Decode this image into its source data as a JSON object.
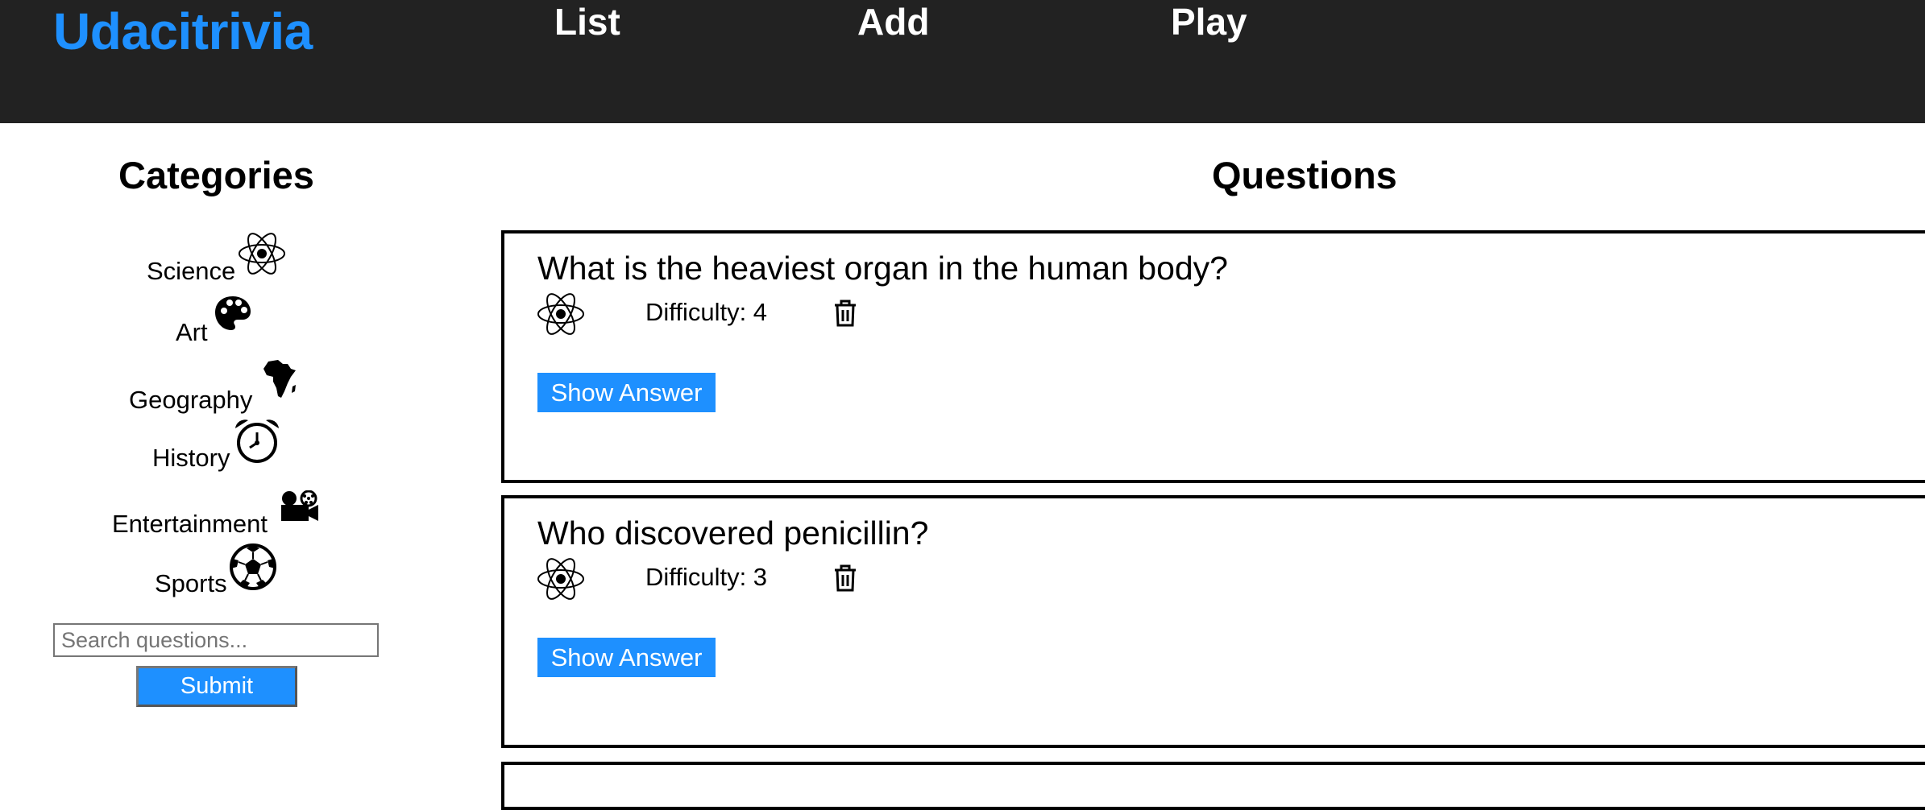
{
  "header": {
    "brand": "Udacitrivia",
    "nav": {
      "list": "List",
      "add": "Add",
      "play": "Play"
    }
  },
  "sidebar": {
    "title": "Categories",
    "categories": [
      {
        "label": "Science",
        "icon": "science-icon"
      },
      {
        "label": "Art",
        "icon": "art-icon"
      },
      {
        "label": "Geography",
        "icon": "geography-icon"
      },
      {
        "label": "History",
        "icon": "history-icon"
      },
      {
        "label": "Entertainment",
        "icon": "entertainment-icon"
      },
      {
        "label": "Sports",
        "icon": "sports-icon"
      }
    ],
    "search": {
      "placeholder": "Search questions...",
      "value": ""
    },
    "submit_label": "Submit"
  },
  "main": {
    "title": "Questions",
    "questions": [
      {
        "text": "What is the heaviest organ in the human body?",
        "difficulty": "Difficulty: 4",
        "category_icon": "science-icon",
        "show_answer_label": "Show Answer"
      },
      {
        "text": "Who discovered penicillin?",
        "difficulty": "Difficulty: 3",
        "category_icon": "science-icon",
        "show_answer_label": "Show Answer"
      }
    ]
  },
  "colors": {
    "header_bg": "#222222",
    "brand": "#1e90ff",
    "button": "#1e90ff"
  }
}
